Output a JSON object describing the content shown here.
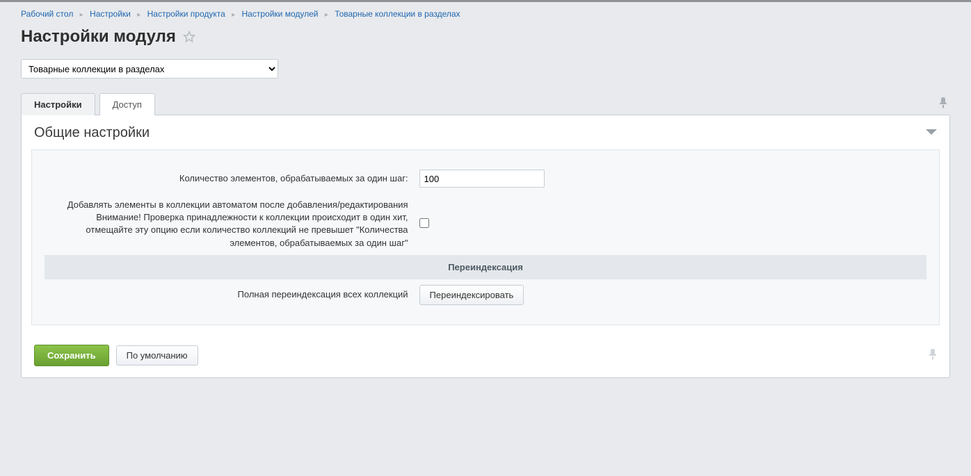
{
  "breadcrumbs": {
    "items": [
      {
        "label": "Рабочий стол"
      },
      {
        "label": "Настройки"
      },
      {
        "label": "Настройки продукта"
      },
      {
        "label": "Настройки модулей"
      },
      {
        "label": "Товарные коллекции в разделах"
      }
    ]
  },
  "page_title": "Настройки модуля",
  "module_select": {
    "selected": "Товарные коллекции в разделах"
  },
  "tabs": {
    "settings": "Настройки",
    "access": "Доступ"
  },
  "section": {
    "title": "Общие настройки",
    "rows": {
      "step_count": {
        "label": "Количество элементов, обрабатываемых за один шаг:",
        "value": "100"
      },
      "auto_add": {
        "label": "Добавлять элементы в коллекции автоматом после добавления/редактирования Внимание! Проверка принадлежности к коллекции происходит в один хит, отмещайте эту опцию если количество коллекций не превышет \"Количества элементов, обрабатываемых за один шаг\""
      },
      "reindex_heading": "Переиндексация",
      "reindex": {
        "label": "Полная переиндексация всех коллекций",
        "button": "Переиндексировать"
      }
    }
  },
  "footer": {
    "save": "Сохранить",
    "default": "По умолчанию"
  }
}
